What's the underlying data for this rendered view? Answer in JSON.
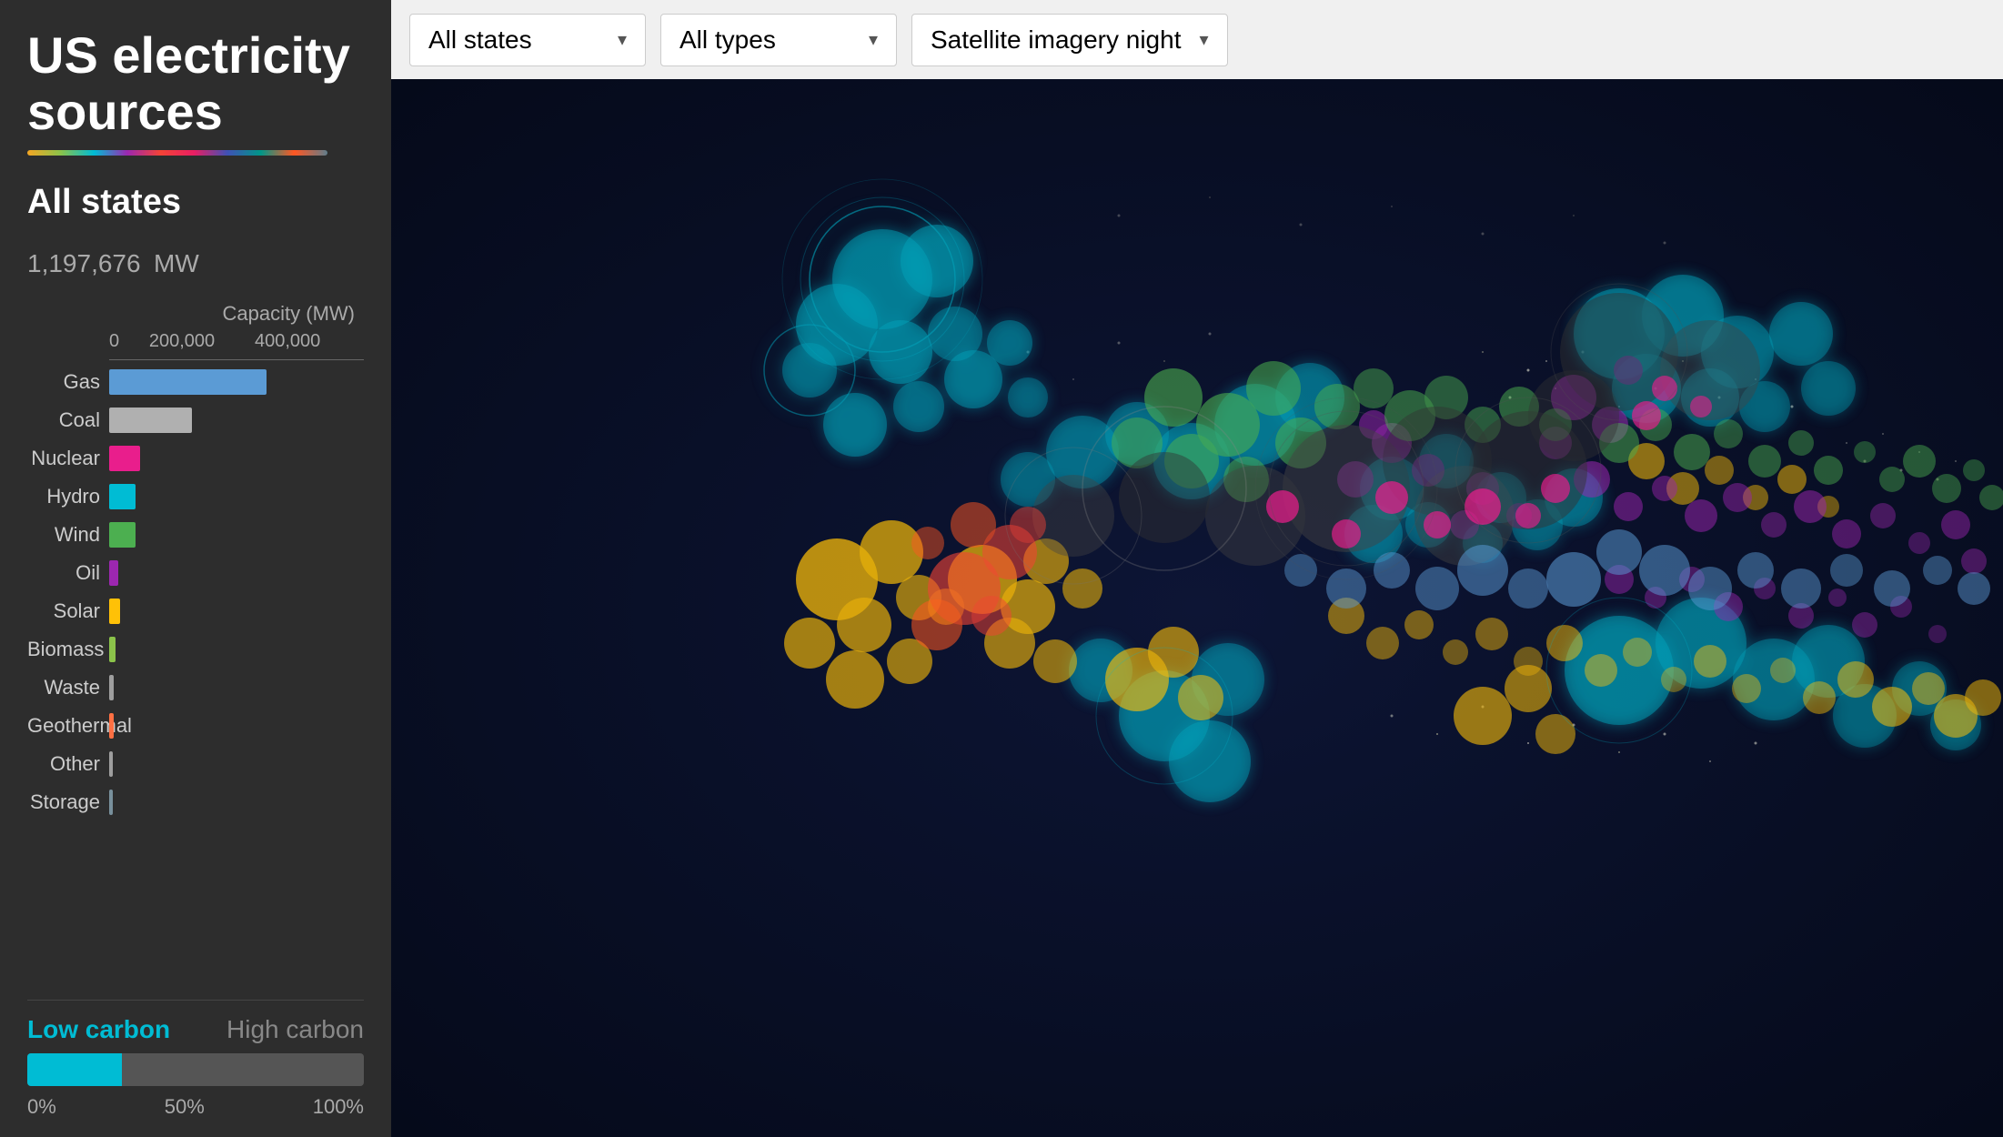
{
  "app": {
    "title": "US electricity sources"
  },
  "toolbar": {
    "states_label": "All states",
    "types_label": "All types",
    "map_label": "Satellite imagery night",
    "chevron": "▾"
  },
  "sidebar": {
    "selected_state": "All states",
    "capacity_value": "1,197,676",
    "capacity_unit": "MW",
    "chart_axis_label": "Capacity (MW)",
    "axis_ticks": [
      "0",
      "200,000",
      "400,000"
    ],
    "bars": [
      {
        "name": "Gas",
        "color": "#5b9bd5",
        "width_pct": 72
      },
      {
        "name": "Coal",
        "color": "#b0b0b0",
        "width_pct": 38
      },
      {
        "name": "Nuclear",
        "color": "#e91e8c",
        "width_pct": 14
      },
      {
        "name": "Hydro",
        "color": "#00bcd4",
        "width_pct": 12
      },
      {
        "name": "Wind",
        "color": "#4caf50",
        "width_pct": 12
      },
      {
        "name": "Oil",
        "color": "#9c27b0",
        "width_pct": 4
      },
      {
        "name": "Solar",
        "color": "#ffc107",
        "width_pct": 5
      },
      {
        "name": "Biomass",
        "color": "#8bc34a",
        "width_pct": 3
      },
      {
        "name": "Waste",
        "color": "#9e9e9e",
        "width_pct": 2
      },
      {
        "name": "Geothermal",
        "color": "#ff7043",
        "width_pct": 2
      },
      {
        "name": "Other",
        "color": "#9e9e9e",
        "width_pct": 1
      },
      {
        "name": "Storage",
        "color": "#78909c",
        "width_pct": 1
      }
    ],
    "carbon": {
      "low_carbon_label": "Low carbon",
      "high_carbon_label": "High carbon",
      "low_pct": 28,
      "axis_start": "0%",
      "axis_mid": "50%",
      "axis_end": "100%"
    }
  }
}
